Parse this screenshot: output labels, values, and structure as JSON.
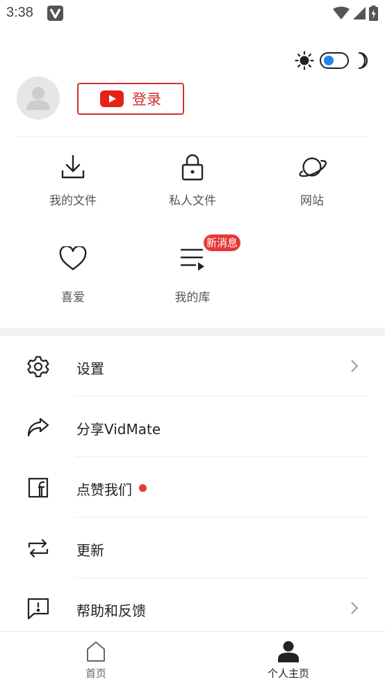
{
  "status_bar": {
    "time": "3:38",
    "icons": [
      "v-app-icon",
      "wifi-icon",
      "signal-icon",
      "battery-charging-icon"
    ]
  },
  "theme": {
    "light_icon": "sun-icon",
    "dark_icon": "moon-icon",
    "toggle_state": "light",
    "accent_color": "#1e88e5"
  },
  "profile": {
    "login_label": "登录",
    "brand_color": "#d32f2f"
  },
  "grid": {
    "items": [
      {
        "label": "我的文件",
        "icon": "download-icon"
      },
      {
        "label": "私人文件",
        "icon": "lock-icon"
      },
      {
        "label": "网站",
        "icon": "planet-icon"
      },
      {
        "label": "喜爱",
        "icon": "heart-icon"
      },
      {
        "label": "我的库",
        "icon": "playlist-icon"
      }
    ],
    "new_badge": "新消息"
  },
  "menu": {
    "items": [
      {
        "label": "设置",
        "icon": "gear-icon"
      },
      {
        "label": "分享VidMate",
        "icon": "share-icon"
      },
      {
        "label": "点赞我们",
        "icon": "facebook-icon"
      },
      {
        "label": "更新",
        "icon": "repeat-icon"
      },
      {
        "label": "帮助和反馈",
        "icon": "feedback-icon"
      }
    ]
  },
  "bottom_nav": {
    "items": [
      {
        "label": "首页",
        "icon": "home-icon"
      },
      {
        "label": "个人主页",
        "icon": "person-icon",
        "active": true
      }
    ]
  }
}
